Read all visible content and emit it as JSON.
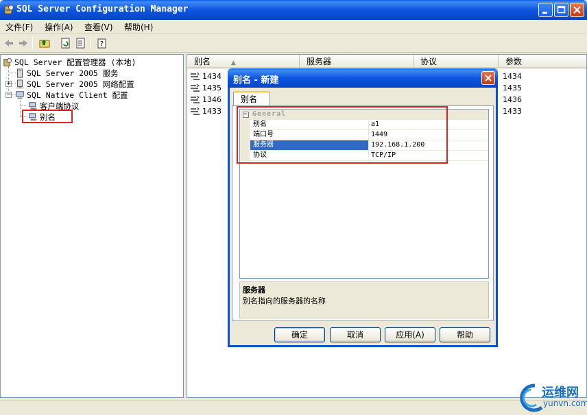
{
  "window": {
    "title": "SQL Server Configuration Manager",
    "minimize_icon": "minimize-icon",
    "maximize_icon": "maximize-icon",
    "close_icon": "close-icon"
  },
  "menu": [
    "文件(F)",
    "操作(A)",
    "查看(V)",
    "帮助(H)"
  ],
  "tree": {
    "root": "SQL Server 配置管理器 (本地)",
    "services": "SQL Server 2005 服务",
    "network": "SQL Server 2005 网络配置",
    "native": "SQL Native Client 配置",
    "client_protocols": "客户端协议",
    "aliases": "别名"
  },
  "list": {
    "columns": [
      "别名",
      "服务器",
      "协议",
      "参数"
    ],
    "rows": [
      {
        "alias": "1434",
        "param": "1434"
      },
      {
        "alias": "1435",
        "param": "1435"
      },
      {
        "alias": "1346",
        "param": "1436"
      },
      {
        "alias": "1433",
        "param": "1433"
      }
    ]
  },
  "dialog": {
    "title": "别名 - 新建",
    "tab": "别名",
    "category": "General",
    "properties": [
      {
        "name": "别名",
        "value": "a1"
      },
      {
        "name": "端口号",
        "value": "1449"
      },
      {
        "name": "服务器",
        "value": "192.168.1.200"
      },
      {
        "name": "协议",
        "value": "TCP/IP"
      }
    ],
    "description_title": "服务器",
    "description_text": "别名指向的服务器的名称",
    "buttons": {
      "ok": "确定",
      "cancel": "取消",
      "apply": "应用(A)",
      "help": "帮助"
    }
  },
  "watermark": {
    "name": "运维网",
    "url": "yunvn.com"
  },
  "colors": {
    "titlebar": "#0a5ee6",
    "highlight": "#d9241f",
    "selection": "#316ac5"
  }
}
